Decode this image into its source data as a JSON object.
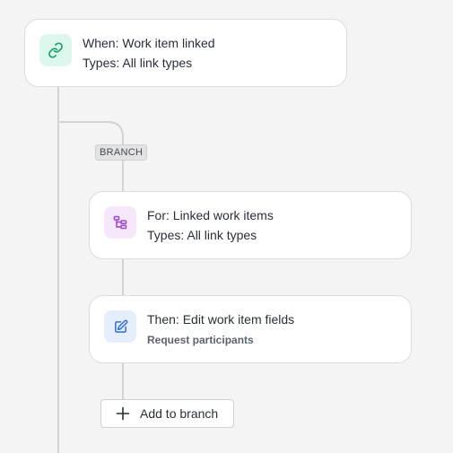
{
  "trigger": {
    "title": "When: Work item linked",
    "subtitle": "Types: All link types",
    "icon": "link-icon",
    "icon_bg": "#dcf7ec",
    "icon_color": "#1f9d6b"
  },
  "branch": {
    "badge": "BRANCH"
  },
  "branch_condition": {
    "title": "For: Linked work items",
    "subtitle": "Types: All link types",
    "icon": "branch-hierarchy-icon",
    "icon_bg": "#f5e8fb",
    "icon_color": "#a04ccf"
  },
  "action": {
    "title": "Then: Edit work item fields",
    "subtitle": "Request participants",
    "icon": "edit-pencil-icon",
    "icon_bg": "#e6eefc",
    "icon_color": "#2f6ad8"
  },
  "add_branch": {
    "label": "Add to branch",
    "icon": "plus-icon"
  }
}
